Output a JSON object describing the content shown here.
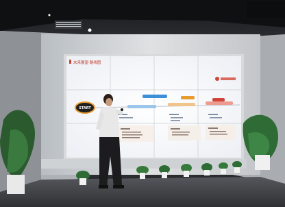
{
  "scene": {
    "description_kind": "photo",
    "screen": {
      "title_text": "未来展望·路线图",
      "start_badge": "START",
      "logo_text": "",
      "columns": [
        {
          "heading": "",
          "pill": "",
          "body": "",
          "note": ""
        },
        {
          "heading": "",
          "pill": "",
          "body": "",
          "note": ""
        },
        {
          "heading": "",
          "pill": "",
          "body": "",
          "note": ""
        },
        {
          "heading": "",
          "pill": "",
          "body": "",
          "note": ""
        }
      ]
    },
    "colors": {
      "ceiling": "#1b1d21",
      "side_wall": "#cfd3d6",
      "wall_frame": "#e7e8e6",
      "screen_bg": "#fbfbfd",
      "accent_red": "#d0453a",
      "accent_blue": "#3d8fd8",
      "accent_orange": "#e69a2f",
      "floor": "#3b3d42",
      "plant": "#2f6b35",
      "speaker_shirt": "#e8e8e8",
      "speaker_pants": "#1c1c1f"
    }
  }
}
